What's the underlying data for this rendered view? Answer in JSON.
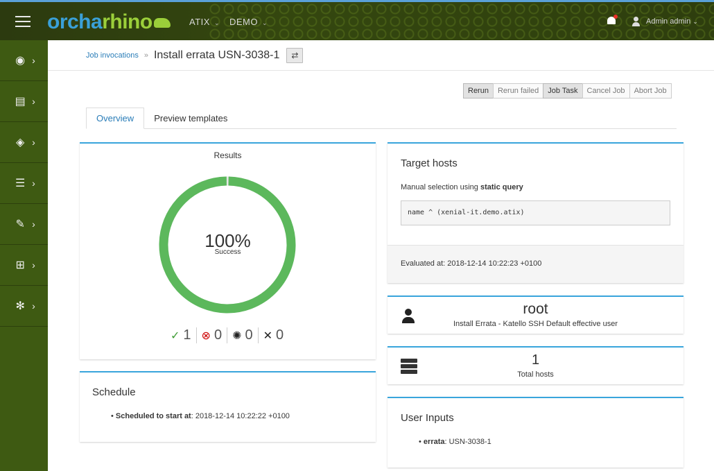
{
  "header": {
    "logo_part1": "orcha",
    "logo_part2": "rhino",
    "org": "ATIX",
    "location": "DEMO",
    "user": "Admin admin"
  },
  "sidebar": {
    "items": [
      {
        "icon": "dashboard-icon",
        "glyph": "◉"
      },
      {
        "icon": "book-icon",
        "glyph": "▤"
      },
      {
        "icon": "cube-icon",
        "glyph": "◈"
      },
      {
        "icon": "server-icon",
        "glyph": "☰"
      },
      {
        "icon": "wrench-icon",
        "glyph": "✎"
      },
      {
        "icon": "network-icon",
        "glyph": "⊞"
      },
      {
        "icon": "cog-icon",
        "glyph": "✻"
      }
    ]
  },
  "breadcrumb": {
    "link": "Job invocations",
    "sep": "»",
    "title": "Install errata USN-3038-1"
  },
  "actions": {
    "rerun": "Rerun",
    "rerun_failed": "Rerun failed",
    "job_task": "Job Task",
    "cancel_job": "Cancel Job",
    "abort_job": "Abort Job"
  },
  "tabs": {
    "overview": "Overview",
    "preview": "Preview templates"
  },
  "results": {
    "title": "Results",
    "percent": "100%",
    "label": "Success",
    "success_count": "1",
    "failed_count": "0",
    "pending_count": "0",
    "cancelled_count": "0",
    "success_fraction": 1.0,
    "colors": {
      "success": "#5cb85c"
    }
  },
  "schedule": {
    "title": "Schedule",
    "label": "Scheduled to start at",
    "value": ": 2018-12-14 10:22:22 +0100"
  },
  "target": {
    "title": "Target hosts",
    "selection_prefix": "Manual selection using ",
    "selection_type": "static query",
    "query": "name ^ (xenial-it.demo.atix)",
    "evaluated": "Evaluated at: 2018-12-14 10:22:23 +0100"
  },
  "user_card": {
    "value": "root",
    "sub": "Install Errata - Katello SSH Default effective user"
  },
  "hosts_card": {
    "value": "1",
    "sub": "Total hosts"
  },
  "inputs": {
    "title": "User Inputs",
    "key": "errata",
    "value": ": USN-3038-1"
  }
}
